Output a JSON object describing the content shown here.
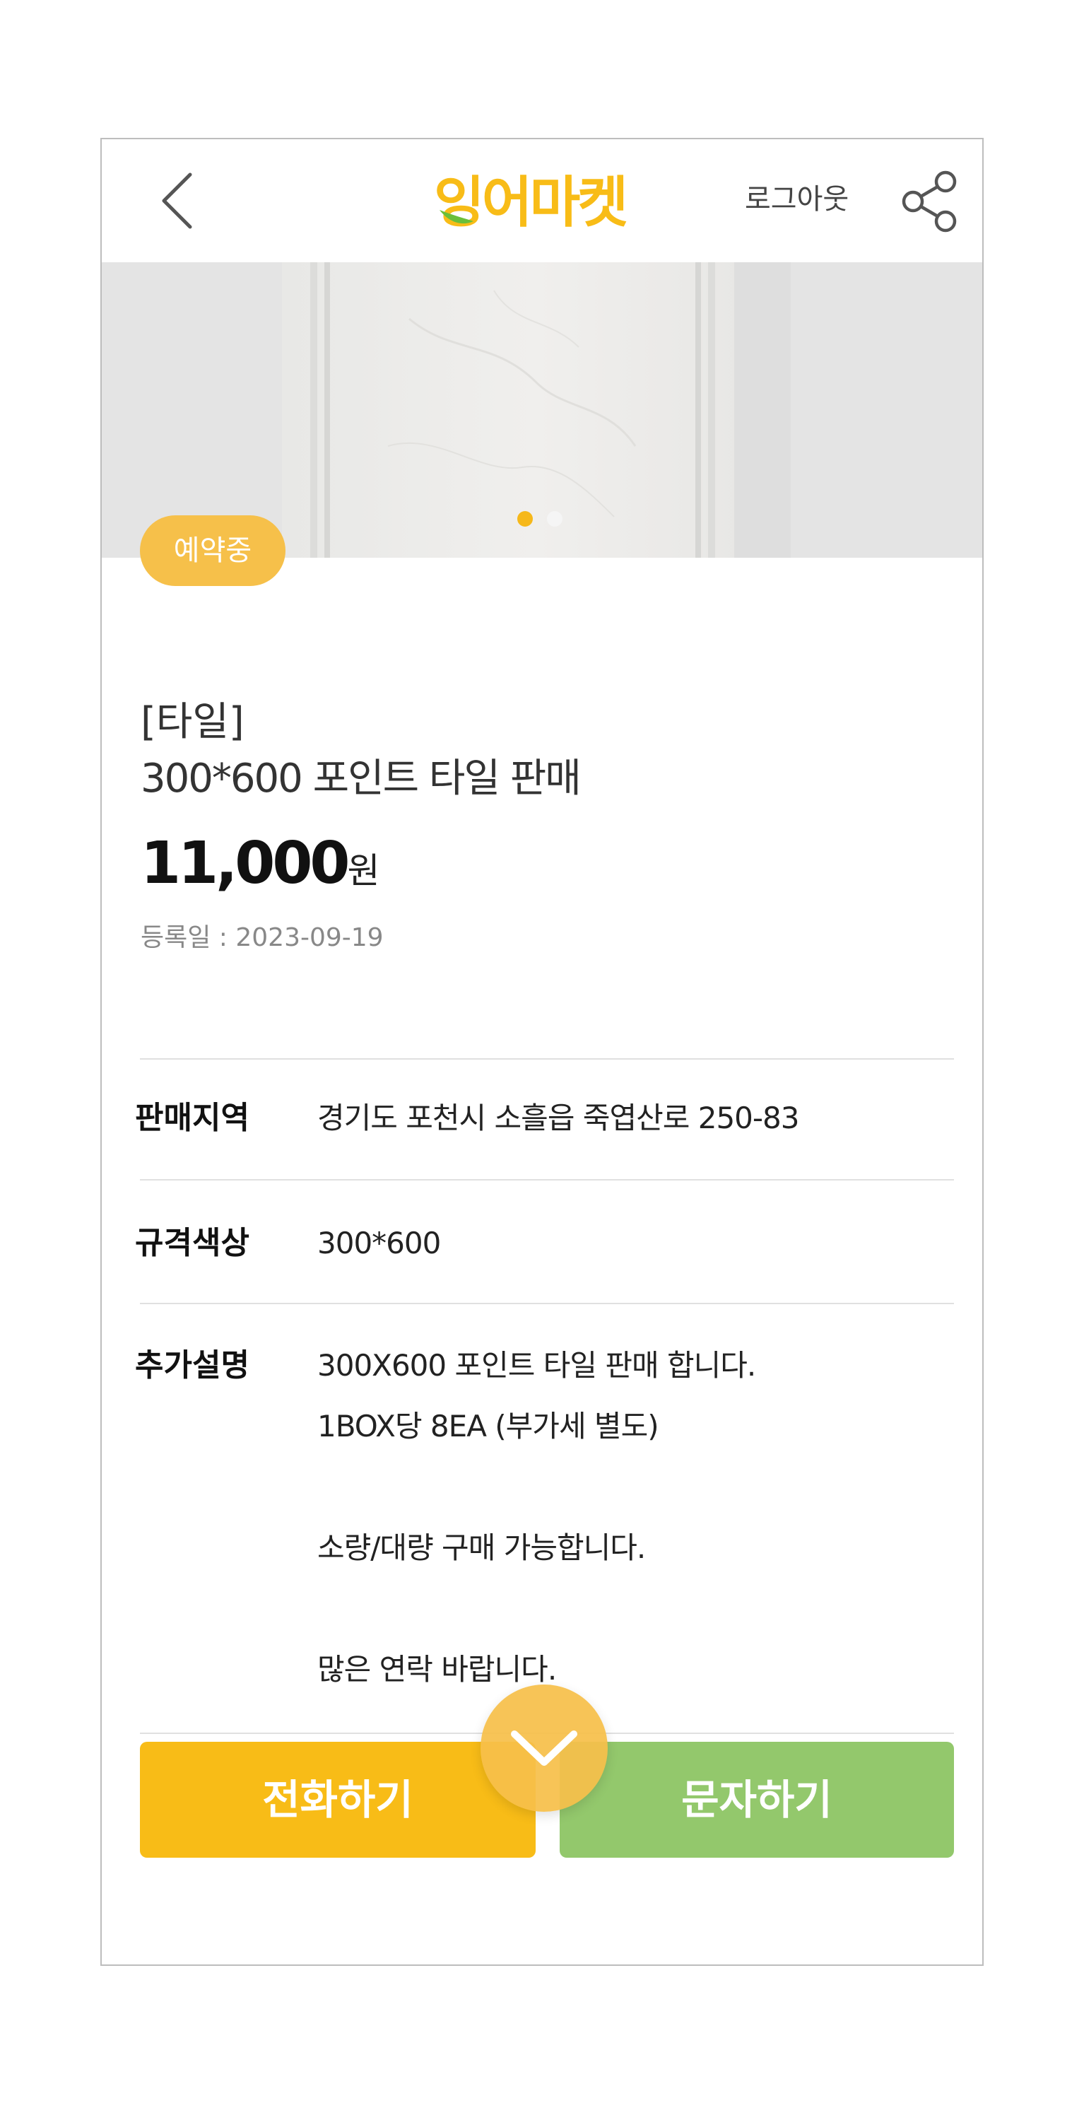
{
  "header": {
    "logo_text": "잉어마켓",
    "logout_label": "로그아웃"
  },
  "carousel": {
    "total_slides": 2,
    "active_slide": 1,
    "status_badge": "예약중"
  },
  "product": {
    "category": "[타일]",
    "title": "300*600 포인트 타일 판매",
    "price": "11,000",
    "price_unit": "원",
    "registered": "등록일 : 2023-09-19"
  },
  "details": {
    "region_label": "판매지역",
    "region_value": "경기도 포천시 소흘읍 죽엽산로 250-83",
    "spec_label": "규격색상",
    "spec_value": "300*600",
    "desc_label": "추가설명",
    "desc_lines": [
      "300X600 포인트 타일 판매 합니다.",
      "1BOX당 8EA (부가세 별도)",
      "",
      "소량/대량 구매 가능합니다.",
      "",
      "많은 연락 바랍니다."
    ]
  },
  "actions": {
    "call_label": "전화하기",
    "sms_label": "문자하기"
  },
  "colors": {
    "accent_yellow": "#f8bc17",
    "badge_yellow": "#f6c04a",
    "green": "#93c86c",
    "logo_leaf": "#6abf3a"
  },
  "icons": {
    "back": "chevron-left-icon",
    "share": "share-icon",
    "scroll": "chevron-down-icon"
  }
}
